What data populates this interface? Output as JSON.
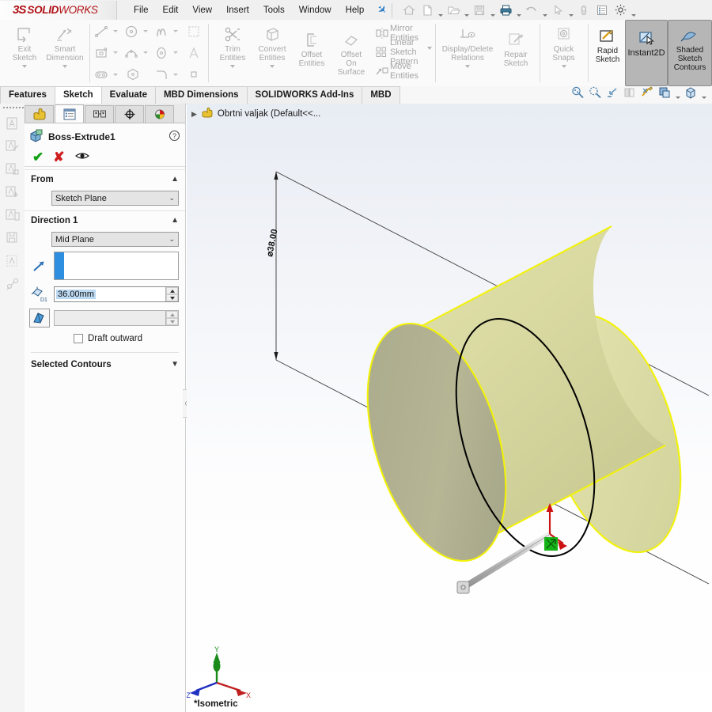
{
  "app": {
    "brand_ds": "3S",
    "brand_solid": "SOLID",
    "brand_works": "WORKS",
    "accent_red": "#b01116",
    "accent_blue": "#2e8fe0",
    "accent_yellow": "#e3e39a",
    "accent_green": "#11a011"
  },
  "menubar": {
    "items": [
      {
        "label": "File"
      },
      {
        "label": "Edit"
      },
      {
        "label": "View"
      },
      {
        "label": "Insert"
      },
      {
        "label": "Tools"
      },
      {
        "label": "Window"
      },
      {
        "label": "Help"
      }
    ],
    "pin_icon": "pushpin-icon",
    "quick_access": [
      {
        "name": "home-icon",
        "has_dropdown": false
      },
      {
        "name": "new-document-icon",
        "has_dropdown": true
      },
      {
        "name": "open-folder-icon",
        "has_dropdown": true
      },
      {
        "name": "save-icon",
        "has_dropdown": true
      },
      {
        "name": "print-icon",
        "has_dropdown": true
      },
      {
        "name": "undo-icon",
        "has_dropdown": true
      },
      {
        "name": "select-cursor-icon",
        "has_dropdown": true
      },
      {
        "name": "capsule-icon",
        "has_dropdown": false
      },
      {
        "name": "options-list-icon",
        "has_dropdown": false
      },
      {
        "name": "gear-icon",
        "has_dropdown": true
      }
    ]
  },
  "ribbon": {
    "group_exit": [
      {
        "label": "Exit\nSketch",
        "line1": "Exit",
        "line2": "Sketch",
        "icon": "exit-sketch-icon",
        "dropdown": true,
        "enabled": false
      },
      {
        "label": "Smart Dimension",
        "line1": "Smart",
        "line2": "Dimension",
        "icon": "smart-dimension-icon",
        "dropdown": true,
        "enabled": false
      }
    ],
    "sketch_tools": [
      {
        "icon": "line-icon",
        "dropdown": true
      },
      {
        "icon": "circle-icon",
        "dropdown": true
      },
      {
        "icon": "spline-icon",
        "dropdown": true
      },
      {
        "icon": "trim-area-icon",
        "dropdown": false
      },
      {
        "icon": "rectangle-icon",
        "dropdown": true
      },
      {
        "icon": "arc-icon",
        "dropdown": true
      },
      {
        "icon": "ellipse-icon",
        "dropdown": true
      },
      {
        "icon": "text-icon",
        "dropdown": false
      },
      {
        "icon": "slot-icon",
        "dropdown": true
      },
      {
        "icon": "polygon-icon",
        "dropdown": false
      },
      {
        "icon": "fillet-icon",
        "dropdown": true
      },
      {
        "icon": "point-icon",
        "dropdown": false
      }
    ],
    "edit_group": [
      {
        "line1": "Trim",
        "line2": "Entities",
        "icon": "trim-entities-icon",
        "dropdown": true
      },
      {
        "line1": "Convert",
        "line2": "Entities",
        "icon": "convert-entities-icon",
        "dropdown": true
      },
      {
        "line1": "Offset",
        "line2": "Entities",
        "icon": "offset-entities-icon",
        "dropdown": false
      },
      {
        "line1": "Offset",
        "line2": "On",
        "line3": "Surface",
        "icon": "offset-on-surface-icon",
        "dropdown": false
      }
    ],
    "pattern_list": [
      {
        "label": "Mirror Entities",
        "icon": "mirror-entities-icon"
      },
      {
        "label": "Linear Sketch Pattern",
        "icon": "linear-sketch-pattern-icon"
      },
      {
        "label": "Move Entities",
        "icon": "move-entities-icon"
      }
    ],
    "relations_group": [
      {
        "line1": "Display/Delete",
        "line2": "Relations",
        "icon": "display-delete-relations-icon",
        "dropdown": true,
        "enabled": false
      },
      {
        "line1": "Repair",
        "line2": "Sketch",
        "icon": "repair-sketch-icon",
        "dropdown": false,
        "enabled": false
      }
    ],
    "snaps_group": [
      {
        "line1": "Quick",
        "line2": "Snaps",
        "icon": "quick-snaps-icon",
        "dropdown": true,
        "enabled": false
      }
    ],
    "right_group": [
      {
        "line1": "Rapid",
        "line2": "Sketch",
        "icon": "rapid-sketch-icon",
        "selected": false
      },
      {
        "line1": "Instant2D",
        "line2": "",
        "icon": "instant2d-icon",
        "selected": true
      },
      {
        "line1": "Shaded",
        "line2": "Sketch",
        "line3": "Contours",
        "icon": "shaded-sketch-contours-icon",
        "selected": true
      }
    ]
  },
  "tabs": {
    "items": [
      {
        "label": "Features",
        "active": false
      },
      {
        "label": "Sketch",
        "active": true
      },
      {
        "label": "Evaluate",
        "active": false
      },
      {
        "label": "MBD Dimensions",
        "active": false
      },
      {
        "label": "SOLIDWORKS Add-Ins",
        "active": false
      },
      {
        "label": "MBD",
        "active": false
      }
    ],
    "view_tools": [
      {
        "name": "zoom-to-fit-icon",
        "dropdown": false
      },
      {
        "name": "zoom-to-area-icon",
        "dropdown": false
      },
      {
        "name": "previous-view-icon",
        "dropdown": false
      },
      {
        "name": "section-view-icon",
        "dropdown": false
      },
      {
        "name": "view-orientation-icon",
        "dropdown": false
      },
      {
        "name": "display-style-icon",
        "dropdown": true
      },
      {
        "name": "hide-show-items-icon",
        "dropdown": true
      }
    ]
  },
  "sidebar_strip": {
    "icons": [
      {
        "name": "annotation-a-icon"
      },
      {
        "name": "annotation-edit-icon"
      },
      {
        "name": "annotation-box-icon"
      },
      {
        "name": "annotation-add-icon"
      },
      {
        "name": "annotation-list-icon"
      },
      {
        "name": "annotation-save-icon"
      },
      {
        "name": "annotation-pattern-icon"
      },
      {
        "name": "annotation-link-icon"
      }
    ]
  },
  "property_manager": {
    "tabs": [
      {
        "name": "feature-manager-tab",
        "icon": "yellow-hand-icon",
        "active": false
      },
      {
        "name": "property-manager-tab",
        "icon": "property-list-icon",
        "active": true
      },
      {
        "name": "configuration-manager-tab",
        "icon": "configuration-icon",
        "active": false
      },
      {
        "name": "dimxpert-manager-tab",
        "icon": "crosshair-icon",
        "active": false
      },
      {
        "name": "display-manager-tab",
        "icon": "color-sphere-icon",
        "active": false
      }
    ],
    "title": "Boss-Extrude1",
    "title_icon": "boss-extrude-icon",
    "help_icon": "help-question-icon",
    "actions": {
      "ok": "✔",
      "cancel": "✘",
      "preview_icon": "eye-icon"
    },
    "sections": [
      {
        "id": "from",
        "label": "From",
        "expanded": true,
        "chevron": "▲",
        "select_value": "Sketch Plane"
      },
      {
        "id": "direction1",
        "label": "Direction 1",
        "expanded": true,
        "chevron": "▲",
        "select_value": "Mid Plane",
        "direction_icon": "reverse-direction-icon",
        "direction_value": "",
        "depth_icon": "depth-d1-icon",
        "depth_value": "36.00mm",
        "draft_icon": "draft-angle-icon",
        "draft_value": "",
        "draft_outward_label": "Draft outward",
        "draft_outward_checked": false
      },
      {
        "id": "selected_contours",
        "label": "Selected Contours",
        "expanded": false,
        "chevron": "▼"
      }
    ]
  },
  "graphics": {
    "feature_tree_root": "Obrtni valjak  (Default<<...",
    "feature_tree_icon": "part-hand-icon",
    "feature_tree_arrow": "▶",
    "dimension_label": "⌀38.00",
    "view_label": "*Isometric",
    "triad": {
      "x_label": "X",
      "y_label": "Y",
      "z_label": "Z",
      "x_color": "#c02020",
      "y_color": "#1a8a1a",
      "z_color": "#2030c0"
    },
    "model": {
      "name": "cylinder-preview",
      "face_color": "#d8d8a0",
      "shade_color": "#a0a083",
      "highlight_edge_color": "#f2f20a",
      "sketch_edge_color": "#000000"
    }
  }
}
